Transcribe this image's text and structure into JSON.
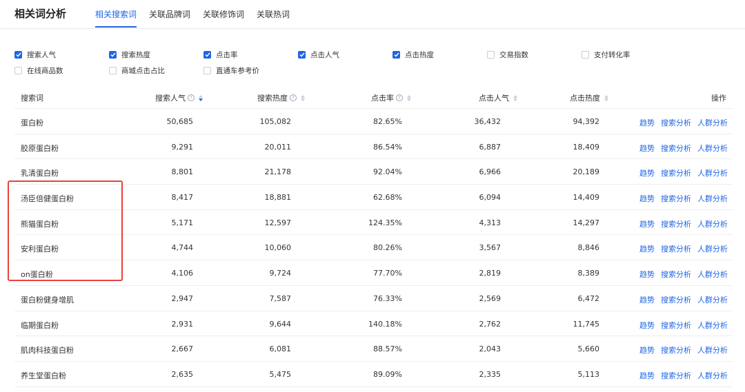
{
  "header": {
    "title": "相关词分析",
    "tabs": [
      {
        "label": "相关搜索词",
        "active": true
      },
      {
        "label": "关联品牌词",
        "active": false
      },
      {
        "label": "关联修饰词",
        "active": false
      },
      {
        "label": "关联热词",
        "active": false
      }
    ]
  },
  "filters": [
    {
      "label": "搜索人气",
      "checked": true
    },
    {
      "label": "搜索热度",
      "checked": true
    },
    {
      "label": "点击率",
      "checked": true
    },
    {
      "label": "点击人气",
      "checked": true
    },
    {
      "label": "点击热度",
      "checked": true
    },
    {
      "label": "交易指数",
      "checked": false
    },
    {
      "label": "支付转化率",
      "checked": false
    },
    {
      "label": "在线商品数",
      "checked": false
    },
    {
      "label": "商城点击占比",
      "checked": false
    },
    {
      "label": "直通车参考价",
      "checked": false
    }
  ],
  "table": {
    "columns": {
      "keyword": "搜索词",
      "search_popularity": "搜索人气",
      "search_heat": "搜索热度",
      "ctr": "点击率",
      "click_popularity": "点击人气",
      "click_heat": "点击热度",
      "ops": "操作"
    },
    "sorted_by": "搜索人气",
    "sort_direction": "desc",
    "row_actions": [
      "趋势",
      "搜索分析",
      "人群分析"
    ],
    "rows": [
      {
        "keyword": "蛋白粉",
        "search_popularity": "50,685",
        "search_heat": "105,082",
        "ctr": "82.65%",
        "click_popularity": "36,432",
        "click_heat": "94,392"
      },
      {
        "keyword": "胶原蛋白粉",
        "search_popularity": "9,291",
        "search_heat": "20,011",
        "ctr": "86.54%",
        "click_popularity": "6,887",
        "click_heat": "18,409"
      },
      {
        "keyword": "乳清蛋白粉",
        "search_popularity": "8,801",
        "search_heat": "21,178",
        "ctr": "92.04%",
        "click_popularity": "6,966",
        "click_heat": "20,189"
      },
      {
        "keyword": "汤臣倍健蛋白粉",
        "search_popularity": "8,417",
        "search_heat": "18,881",
        "ctr": "62.68%",
        "click_popularity": "6,094",
        "click_heat": "14,409"
      },
      {
        "keyword": "熊猫蛋白粉",
        "search_popularity": "5,171",
        "search_heat": "12,597",
        "ctr": "124.35%",
        "click_popularity": "4,313",
        "click_heat": "14,297"
      },
      {
        "keyword": "安利蛋白粉",
        "search_popularity": "4,744",
        "search_heat": "10,060",
        "ctr": "80.26%",
        "click_popularity": "3,567",
        "click_heat": "8,846"
      },
      {
        "keyword": "on蛋白粉",
        "search_popularity": "4,106",
        "search_heat": "9,724",
        "ctr": "77.70%",
        "click_popularity": "2,819",
        "click_heat": "8,389"
      },
      {
        "keyword": "蛋白粉健身增肌",
        "search_popularity": "2,947",
        "search_heat": "7,587",
        "ctr": "76.33%",
        "click_popularity": "2,569",
        "click_heat": "6,472"
      },
      {
        "keyword": "临期蛋白粉",
        "search_popularity": "2,931",
        "search_heat": "9,644",
        "ctr": "140.18%",
        "click_popularity": "2,762",
        "click_heat": "11,745"
      },
      {
        "keyword": "肌肉科技蛋白粉",
        "search_popularity": "2,667",
        "search_heat": "6,081",
        "ctr": "88.57%",
        "click_popularity": "2,043",
        "click_heat": "5,660"
      },
      {
        "keyword": "养生堂蛋白粉",
        "search_popularity": "2,635",
        "search_heat": "5,475",
        "ctr": "89.09%",
        "click_popularity": "2,335",
        "click_heat": "5,113"
      }
    ]
  },
  "colors": {
    "accent": "#1f66e5",
    "highlight_border": "#e8413a"
  }
}
